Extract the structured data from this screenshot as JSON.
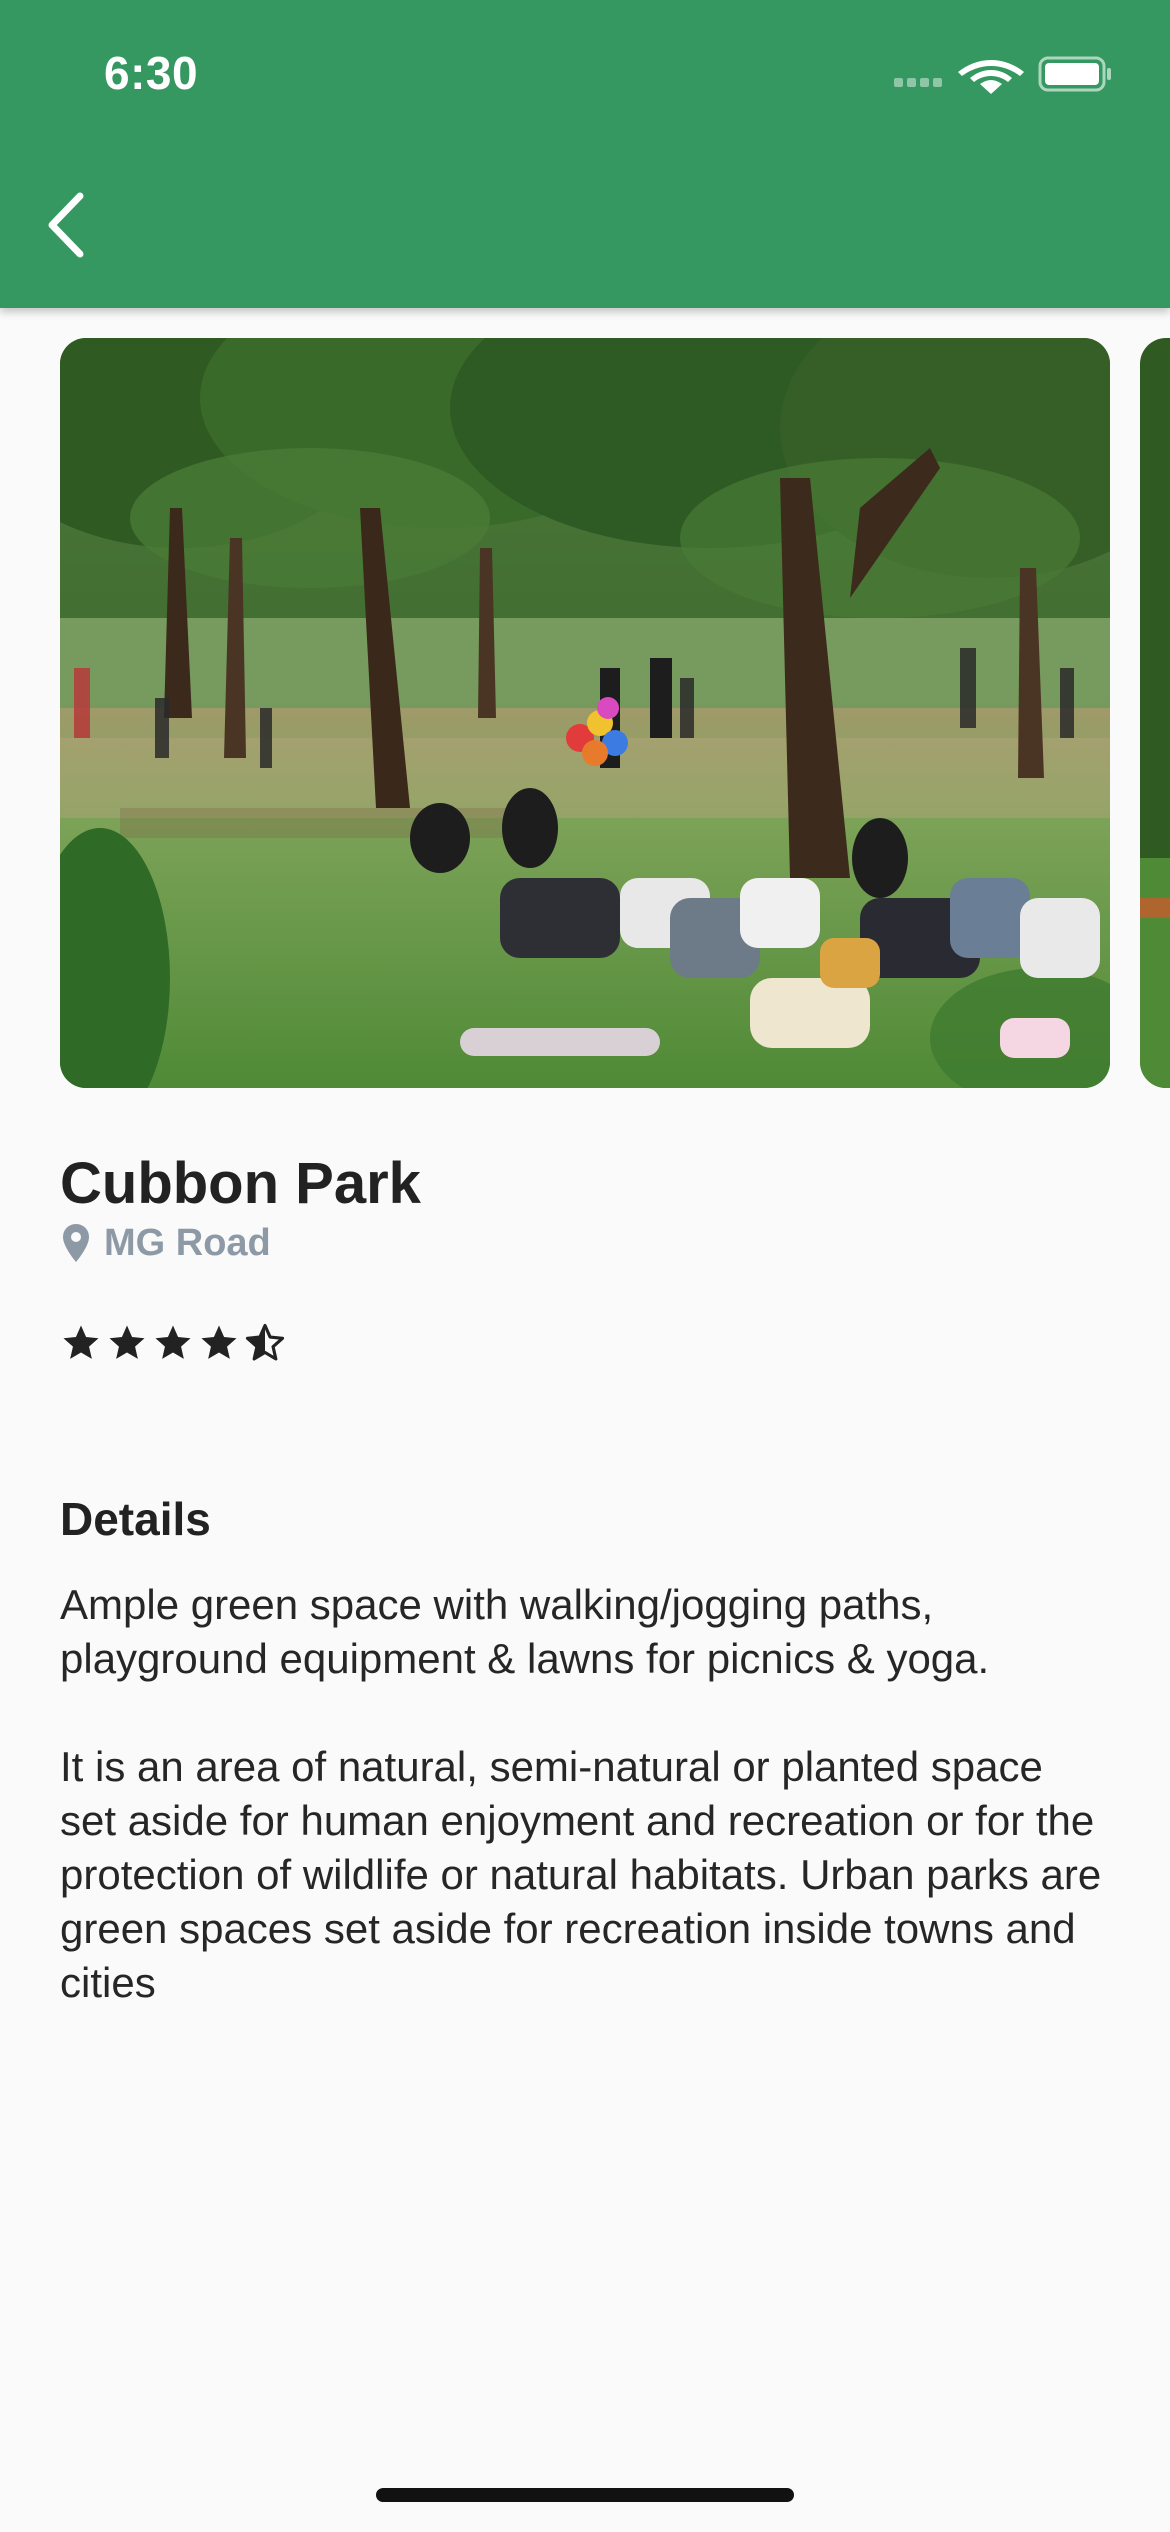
{
  "status_bar": {
    "time": "6:30"
  },
  "header": {
    "back_icon": "chevron-left-icon",
    "background": "#349860"
  },
  "park": {
    "name": "Cubbon Park",
    "location": "MG Road",
    "rating": 4.5,
    "rating_max": 5
  },
  "details": {
    "heading": "Details",
    "paragraphs": [
      "Ample green space with walking/jogging paths, playground equipment & lawns for picnics & yoga.",
      "It is an area of natural, semi-natural or planted space set aside for human enjoyment and recreation or for the protection of wildlife or natural habitats.  Urban parks are green spaces set aside for recreation inside towns and cities"
    ]
  },
  "colors": {
    "accent": "#349860",
    "location_text": "#8d9aa6",
    "star": "#222222"
  }
}
